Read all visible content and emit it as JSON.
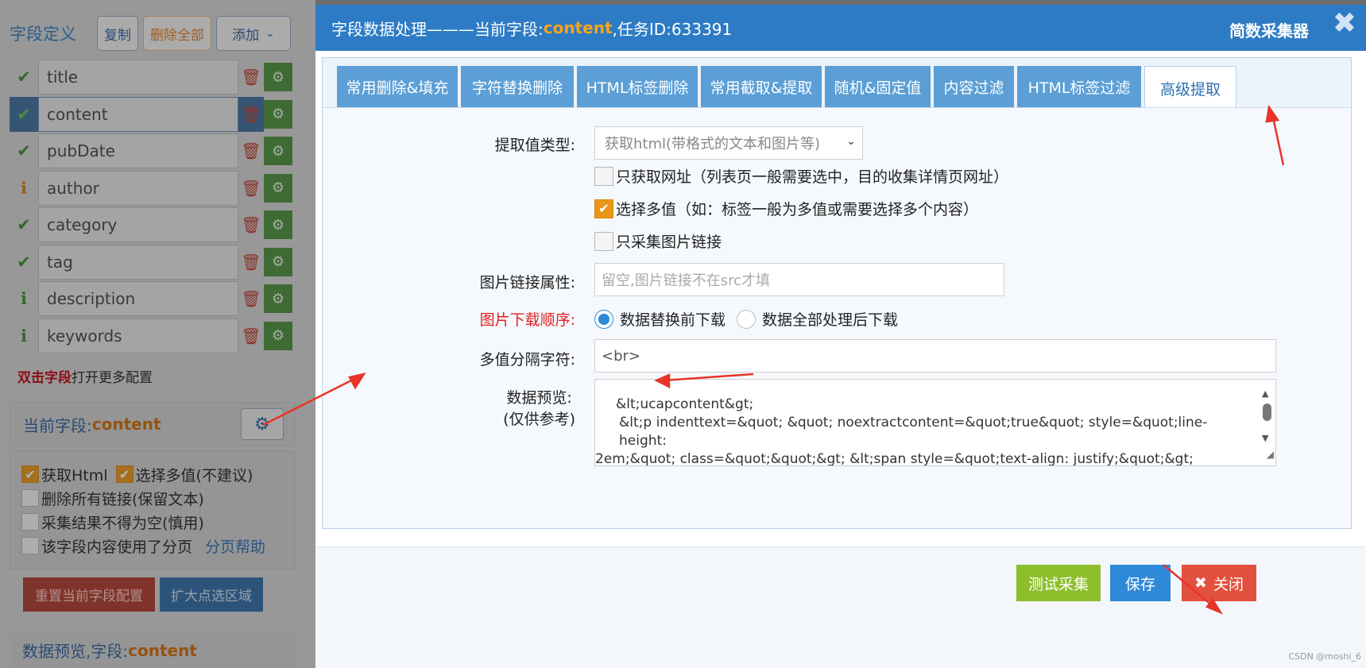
{
  "left_panel": {
    "title": "字段定义",
    "copy_button": "复制",
    "delete_all_button": "删除全部",
    "add_button": "添加",
    "fields": [
      {
        "name": "title",
        "status": "ok",
        "selected": false
      },
      {
        "name": "content",
        "status": "ok",
        "selected": true
      },
      {
        "name": "pubDate",
        "status": "ok",
        "selected": false
      },
      {
        "name": "author",
        "status": "info",
        "selected": false
      },
      {
        "name": "category",
        "status": "ok",
        "selected": false
      },
      {
        "name": "tag",
        "status": "ok",
        "selected": false
      },
      {
        "name": "description",
        "status": "info",
        "selected": false
      },
      {
        "name": "keywords",
        "status": "info",
        "selected": false
      }
    ],
    "dblclick_hint_bold": "双击字段",
    "dblclick_hint_rest": "打开更多配置",
    "current_field_label": "当前字段:",
    "current_field_value": "content",
    "options": {
      "get_html": "获取Html",
      "multi_value": "选择多值(不建议)",
      "remove_links": "删除所有链接(保留文本)",
      "not_empty": "采集结果不得为空(慎用)",
      "paging": "该字段内容使用了分页",
      "paging_help": "分页帮助"
    },
    "reset_button": "重置当前字段配置",
    "expand_button": "扩大点选区域",
    "data_preview_label": "数据预览,字段:",
    "data_preview_field": "content"
  },
  "modal": {
    "title_prefix": "字段数据处理———当前字段: ",
    "title_field": "content",
    "title_suffix": ",任务ID:633391",
    "brand": "简数采集器",
    "close_glyph": "✖",
    "tabs": [
      {
        "label": "常用删除&填充",
        "active": false
      },
      {
        "label": "字符替换删除",
        "active": false
      },
      {
        "label": "HTML标签删除",
        "active": false
      },
      {
        "label": "常用截取&提取",
        "active": false
      },
      {
        "label": "随机&固定值",
        "active": false
      },
      {
        "label": "内容过滤",
        "active": false
      },
      {
        "label": "HTML标签过滤",
        "active": false
      },
      {
        "label": "高级提取",
        "active": true
      }
    ],
    "form": {
      "value_type_label": "提取值类型:",
      "value_type_selected": "获取html(带格式的文本和图片等)",
      "only_url": "只获取网址（列表页一般需要选中，目的收集详情页网址）",
      "only_url_checked": false,
      "multi_value": "选择多值（如：标签一般为多值或需要选择多个内容）",
      "multi_value_checked": true,
      "only_img": "只采集图片链接",
      "only_img_checked": false,
      "img_attr_label": "图片链接属性:",
      "img_attr_placeholder": "留空,图片链接不在src才填",
      "img_order_label": "图片下载顺序:",
      "img_order_opt1": "数据替换前下载",
      "img_order_opt2": "数据全部处理后下载",
      "img_order_selected": 1,
      "separator_label": "多值分隔字符:",
      "separator_value": "<br>",
      "preview_label_1": "数据预览:",
      "preview_label_2": "(仅供参考)",
      "preview_line_1": "&lt;ucapcontent&gt;",
      "preview_line_2": "&lt;p indenttext=&quot;        &quot; noextractcontent=&quot;true&quot; style=&quot;line-height:",
      "preview_line_3": "2em;&quot; class=&quot;&quot;&gt;        &lt;span style=&quot;text-align: justify;&quot;&gt;"
    },
    "footer": {
      "test_button": "测试采集",
      "save_button": "保存",
      "close_button": "关闭"
    }
  },
  "watermark": "CSDN @moshi_6",
  "colors": {
    "header_blue": "#2d7bc4",
    "tab_blue": "#5b9fd6",
    "accent_orange": "#ffa31a",
    "annotation_red": "#e8342a"
  }
}
